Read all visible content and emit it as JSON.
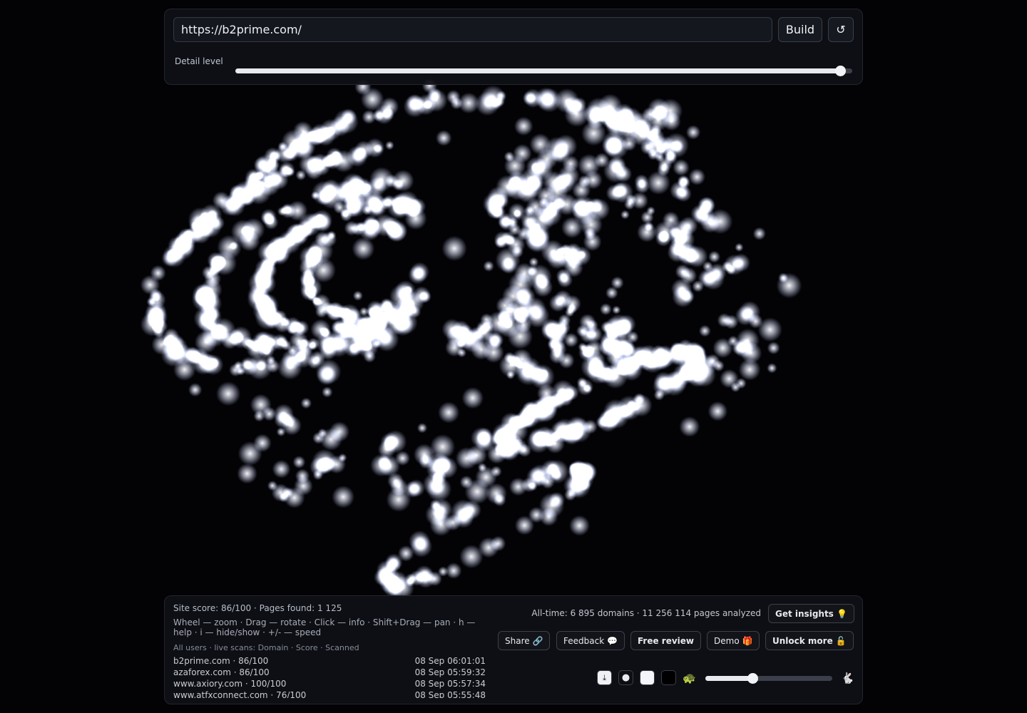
{
  "url_input": {
    "value": "https://b2prime.com/"
  },
  "toolbar": {
    "build_label": "Build",
    "reload_icon": "↺"
  },
  "detail": {
    "label": "Detail level",
    "level": 0.98
  },
  "status": {
    "site_line": "Site score: 86/100 · Pages found: 1 125"
  },
  "help": {
    "text": "Wheel — zoom · Drag — rotate · Click — info · Shift+Drag — pan · h — help · i — hide/show · +/- — speed"
  },
  "feed": {
    "header": "All users · live scans: Domain · Score · Scanned",
    "rows": [
      {
        "domain": "b2prime.com · 86/100",
        "time": "08 Sep 06:01:01"
      },
      {
        "domain": "azaforex.com · 86/100",
        "time": "08 Sep 05:59:32"
      },
      {
        "domain": "www.axiory.com · 100/100",
        "time": "08 Sep 05:57:34"
      },
      {
        "domain": "www.atfxconnect.com · 76/100",
        "time": "08 Sep 05:55:48"
      }
    ]
  },
  "stats": {
    "alltime": "All-time: 6 895 domains · 11 256 114 pages analyzed"
  },
  "buttons": {
    "insights": "Get insights 💡",
    "share": "Share 🔗",
    "feedback": "Feedback 💬",
    "free_review": "Free review",
    "demo": "Demo 🎁",
    "unlock": "Unlock more 🔓"
  },
  "controls": {
    "download_icon": "⤓",
    "dot_icon": "●",
    "slow_icon": "🐢",
    "fast_icon": "🐇",
    "speed_level": 0.37
  },
  "colors": {
    "background": "#030306",
    "panel": "#0e1016",
    "glow": "#ffffff"
  }
}
